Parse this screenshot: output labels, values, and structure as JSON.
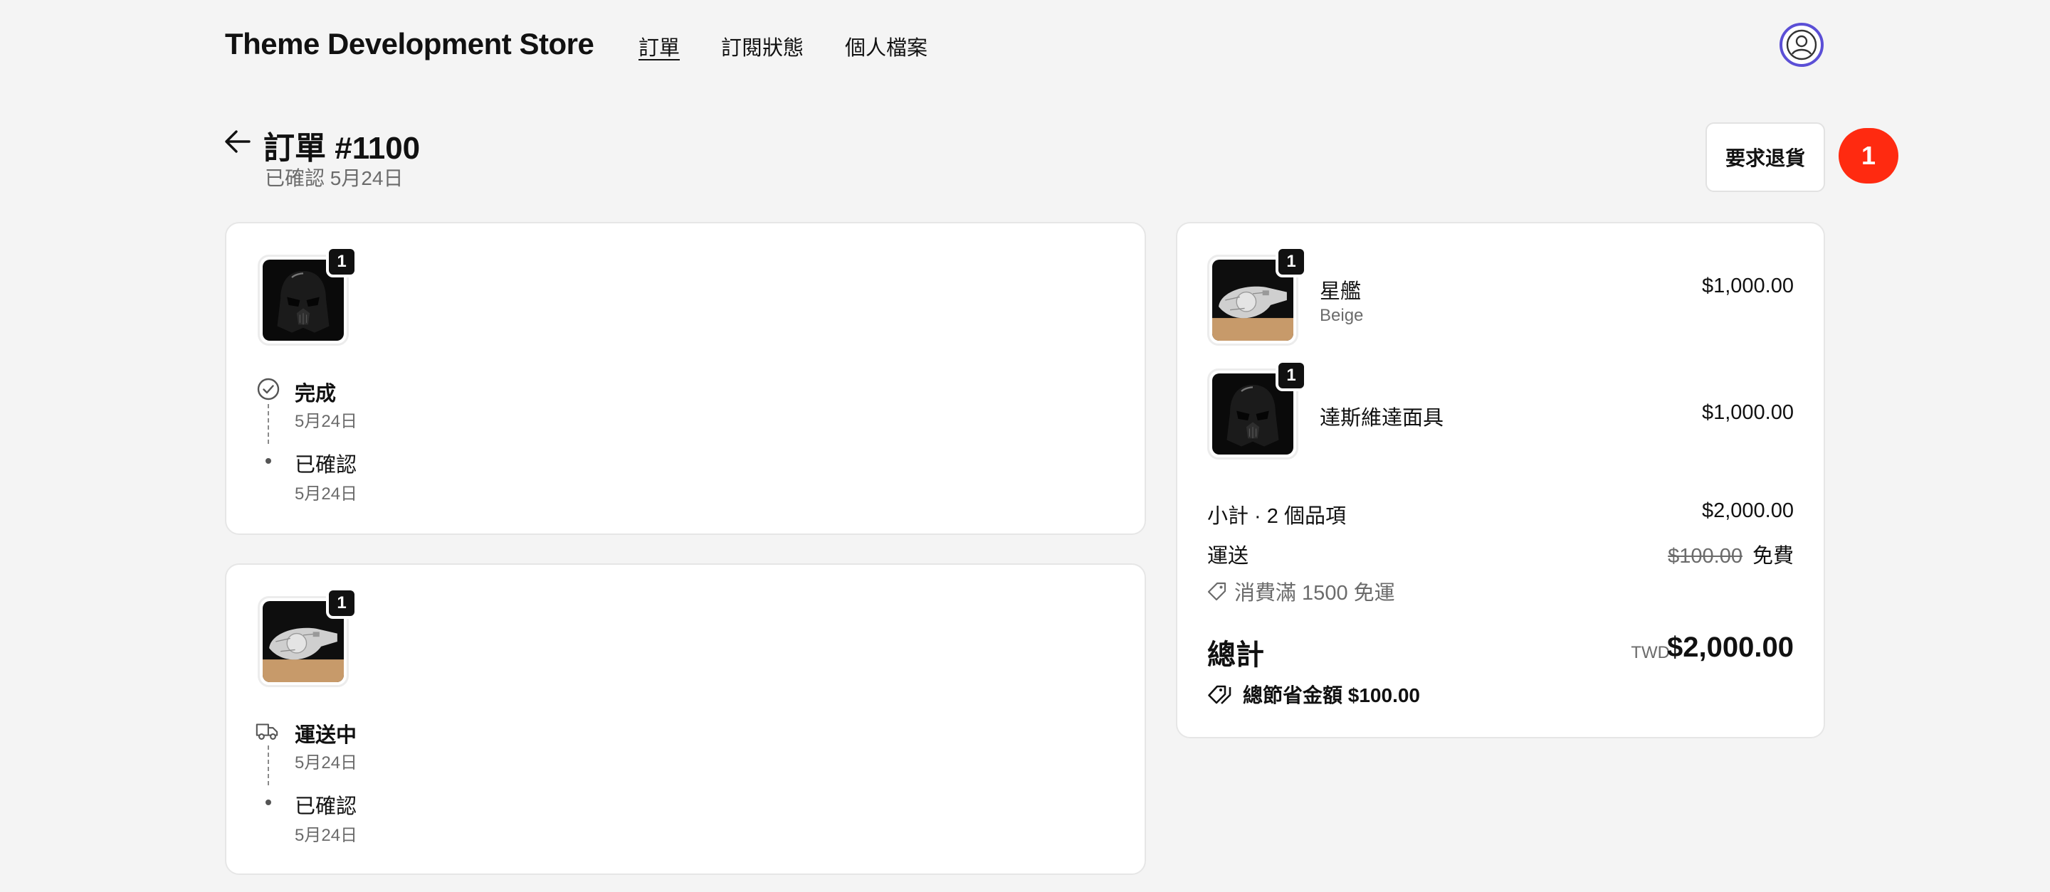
{
  "header": {
    "store_title": "Theme Development Store",
    "nav": [
      "訂單",
      "訂閱狀態",
      "個人檔案"
    ],
    "avatar_icon": "user-circle-icon"
  },
  "order": {
    "title": "訂單 #1100",
    "subtitle": "已確認 5月24日",
    "return_button": "要求退貨",
    "notification_count": "1"
  },
  "fulfillments": [
    {
      "product_icon": "darth-vader-mask-image",
      "quantity": "1",
      "events": [
        {
          "title": "完成",
          "date": "5月24日",
          "icon": "check-circle-icon"
        },
        {
          "title": "已確認",
          "date": "5月24日",
          "icon": "dot"
        }
      ]
    },
    {
      "product_icon": "millennium-falcon-image",
      "quantity": "1",
      "events": [
        {
          "title": "運送中",
          "date": "5月24日",
          "icon": "delivery-truck-icon"
        },
        {
          "title": "已確認",
          "date": "5月24日",
          "icon": "dot"
        }
      ]
    }
  ],
  "summary": {
    "items": [
      {
        "name": "星艦",
        "variant": "Beige",
        "price": "$1,000.00",
        "quantity": "1",
        "image": "millennium-falcon-image"
      },
      {
        "name": "達斯維達面具",
        "variant": "",
        "price": "$1,000.00",
        "quantity": "1",
        "image": "darth-vader-mask-image"
      }
    ],
    "subtotal_label": "小計 · 2 個品項",
    "subtotal_value": "$2,000.00",
    "shipping_label": "運送",
    "shipping_original": "$100.00",
    "shipping_value": "免費",
    "discount_note": "消費滿 1500 免運",
    "total_label": "總計",
    "total_currency": "TWD",
    "total_value": "$2,000.00",
    "savings": "總節省金額 $100.00"
  },
  "colors": {
    "background": "#f4f4f4",
    "notification": "#ff2a10",
    "avatar_ring": "#5b4fd6"
  }
}
